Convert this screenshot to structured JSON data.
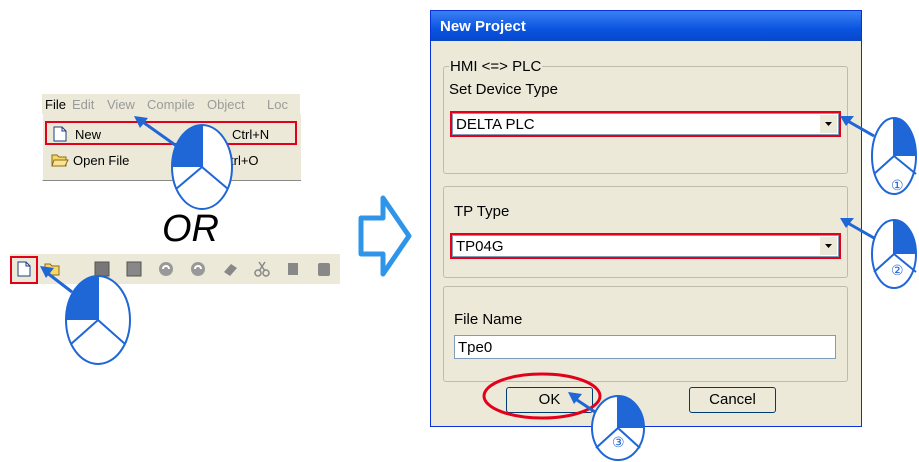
{
  "menu": {
    "bar": [
      "File",
      "Edit",
      "View",
      "Compile",
      "Object",
      "Loc"
    ],
    "items": [
      {
        "label": "New",
        "shortcut": "Ctrl+N"
      },
      {
        "label": "Open File",
        "shortcut": "trl+O"
      }
    ]
  },
  "or_text": "OR",
  "toolbar_icons": [
    "new-file-icon",
    "open-file-icon",
    "save-icon",
    "save-as-icon",
    "compile-icon",
    "compile-all-icon",
    "eraser-icon",
    "cut-icon",
    "copy-icon",
    "paste-icon"
  ],
  "dialog": {
    "title": "New Project",
    "hmi_group": {
      "legend": "HMI <=> PLC",
      "label": "Set Device Type",
      "value": "DELTA PLC"
    },
    "tp_group": {
      "legend": "TP Type",
      "value": "TP04G"
    },
    "file_group": {
      "label": "File Name",
      "value": "Tpe0"
    },
    "ok_label": "OK",
    "cancel_label": "Cancel"
  },
  "callouts": [
    "①",
    "②",
    "③"
  ],
  "colors": {
    "highlight": "#e3001b",
    "mouse": "#1f66d6",
    "arrow": "#2f95e9",
    "titlebar": "#0a54e0"
  }
}
